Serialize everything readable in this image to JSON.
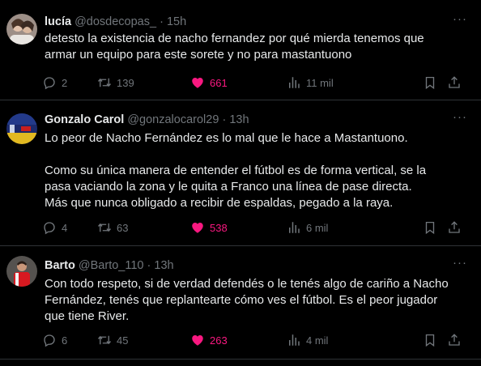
{
  "tweets": [
    {
      "name": "lucía",
      "handle": "@dosdecopas_",
      "sep": "·",
      "time": "15h",
      "text": "detesto la existencia de nacho fernandez por qué mierda tenemos que\narmar un equipo para este sorete y no para mastantuono",
      "replies": "2",
      "retweets": "139",
      "likes": "661",
      "views": "11 mil"
    },
    {
      "name": "Gonzalo Carol",
      "handle": "@gonzalocarol29",
      "sep": "·",
      "time": "13h",
      "text": "Lo peor de Nacho Fernández es lo mal que le hace a Mastantuono.\n\nComo su única manera de entender el fútbol es de forma vertical, se la\npasa vaciando la zona y le quita a Franco una línea de pase directa.\nMás que nunca obligado a recibir de espaldas, pegado a la raya.",
      "replies": "4",
      "retweets": "63",
      "likes": "538",
      "views": "6 mil"
    },
    {
      "name": "Barto",
      "handle": "@Barto_110",
      "sep": "·",
      "time": "13h",
      "text": "Con todo respeto, si de verdad defendés o le tenés algo de cariño a Nacho\nFernández, tenés que replantearte cómo ves el fútbol. Es el peor jugador\nque tiene River.",
      "replies": "6",
      "retweets": "45",
      "likes": "263",
      "views": "4 mil"
    }
  ],
  "colors": {
    "background": "#000000",
    "text": "#e7e9ea",
    "muted": "#71767b",
    "like": "#f91880",
    "divider": "#2f3336"
  },
  "icons": [
    "more-icon",
    "reply-icon",
    "retweet-icon",
    "like-icon",
    "views-icon",
    "bookmark-icon",
    "share-icon"
  ]
}
